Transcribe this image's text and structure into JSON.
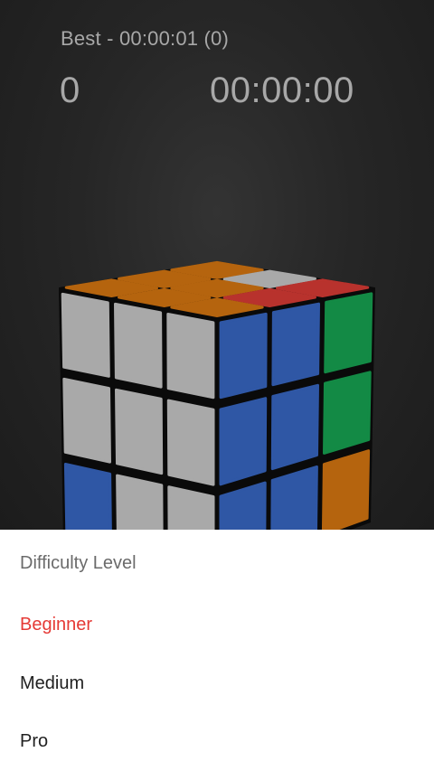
{
  "header": {
    "best": "Best - 00:00:01 (0)",
    "moves": "0",
    "timer": "00:00:00"
  },
  "colors": {
    "white": "#a9a9a9",
    "blue": "#2f57a5",
    "green": "#138a45",
    "orange": "#b5640e",
    "red": "#b8322d",
    "cube_body": "#0a0a0a",
    "selected_option": "#e53935"
  },
  "cube": {
    "top_face": [
      [
        "orange",
        "white",
        "red"
      ],
      [
        "orange",
        "orange",
        "red"
      ],
      [
        "orange",
        "orange",
        "orange"
      ]
    ],
    "front_face": [
      [
        "white",
        "white",
        "white"
      ],
      [
        "white",
        "white",
        "white"
      ],
      [
        "blue",
        "white",
        "white"
      ]
    ],
    "right_face": [
      [
        "blue",
        "blue",
        "green"
      ],
      [
        "blue",
        "blue",
        "green"
      ],
      [
        "blue",
        "blue",
        "orange"
      ]
    ]
  },
  "difficulty_sheet": {
    "title": "Difficulty Level",
    "options": [
      {
        "label": "Beginner",
        "selected": true
      },
      {
        "label": "Medium",
        "selected": false
      },
      {
        "label": "Pro",
        "selected": false
      }
    ]
  }
}
